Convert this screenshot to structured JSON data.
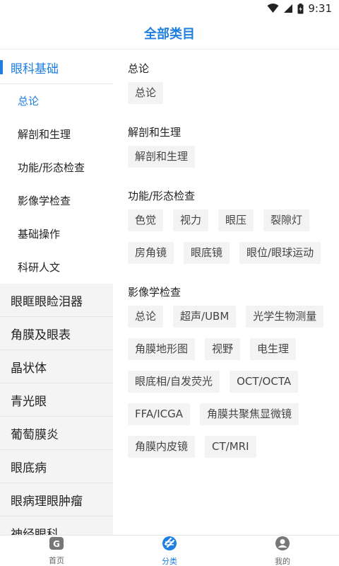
{
  "status_bar": {
    "time": "9:31"
  },
  "header": {
    "title": "全部类目"
  },
  "sidebar": {
    "active_category": "眼科基础",
    "sub_items": [
      "总论",
      "解剖和生理",
      "功能/形态检查",
      "影像学检查",
      "基础操作",
      "科研人文"
    ],
    "categories": [
      "眼眶眼睑泪器",
      "角膜及眼表",
      "晶状体",
      "青光眼",
      "葡萄膜炎",
      "眼底病",
      "眼病理眼肿瘤",
      "神经眼科"
    ]
  },
  "content": {
    "sections": [
      {
        "title": "总论",
        "tags": [
          "总论"
        ]
      },
      {
        "title": "解剖和生理",
        "tags": [
          "解剖和生理"
        ]
      },
      {
        "title": "功能/形态检查",
        "tags": [
          "色觉",
          "视力",
          "眼压",
          "裂隙灯",
          "房角镜",
          "眼底镜",
          "眼位/眼球运动"
        ]
      },
      {
        "title": "影像学检查",
        "tags": [
          "总论",
          "超声/UBM",
          "光学生物测量",
          "角膜地形图",
          "视野",
          "电生理",
          "眼底相/自发荧光",
          "OCT/OCTA",
          "FFA/ICGA",
          "角膜共聚焦显微镜",
          "角膜内皮镜",
          "CT/MRI"
        ]
      }
    ]
  },
  "tabbar": {
    "tabs": [
      {
        "label": "首页",
        "icon": "home-icon"
      },
      {
        "label": "分类",
        "icon": "category-icon"
      },
      {
        "label": "我的",
        "icon": "profile-icon"
      }
    ],
    "active": "分类",
    "accent_color": "#1f7fe0"
  }
}
